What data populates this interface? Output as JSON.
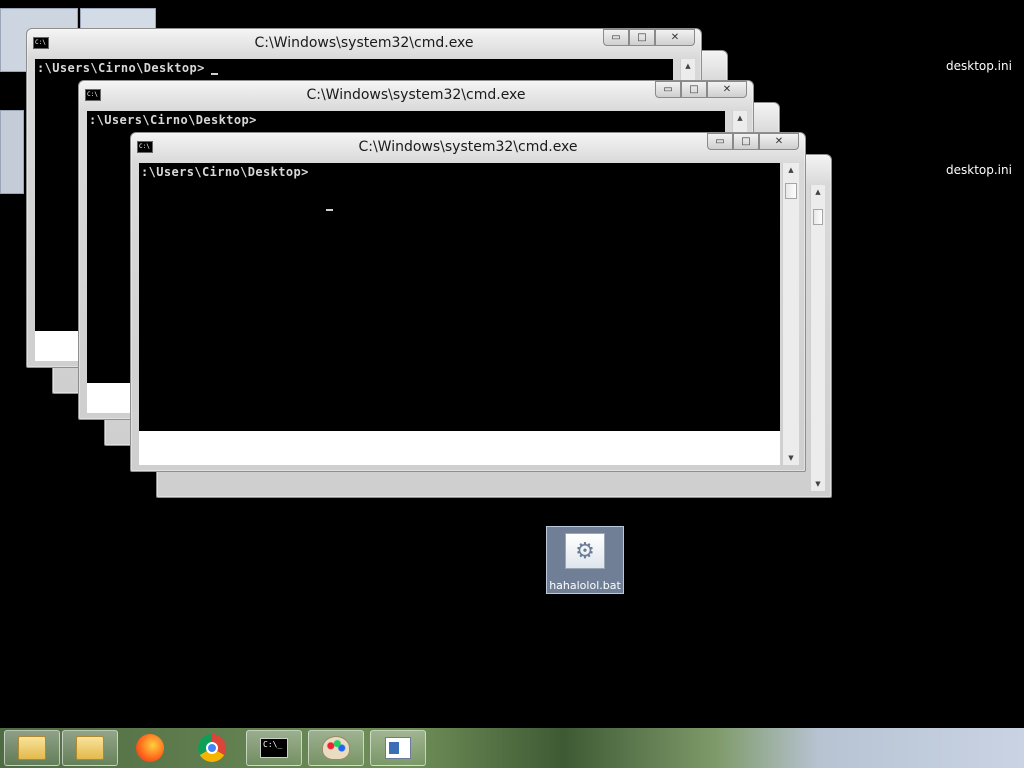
{
  "windows": [
    {
      "title": "C:\\Windows\\system32\\cmd.exe",
      "prompt": ":\\Users\\Cirno\\Desktop>"
    },
    {
      "title": "C:\\Windows\\system32\\cmd.exe",
      "prompt": ":\\Users\\Cirno\\Desktop>"
    },
    {
      "title": "C:\\Windows\\system32\\cmd.exe",
      "prompt": ":\\Users\\Cirno\\Desktop>"
    }
  ],
  "window_controls": {
    "minimize": "▭",
    "maximize": "□",
    "close": "✕"
  },
  "desktop": {
    "labels": [
      "desktop.ini",
      "desktop.ini"
    ],
    "icon": {
      "label": "hahalolol.bat",
      "icon": "batch-file-gear-icon"
    }
  },
  "taskbar": {
    "items": [
      {
        "icon": "folder-icon"
      },
      {
        "icon": "folder-icon"
      },
      {
        "icon": "firefox-icon"
      },
      {
        "icon": "chrome-icon"
      },
      {
        "icon": "cmd-icon",
        "text": "C:\\_"
      },
      {
        "icon": "paint-icon"
      },
      {
        "icon": "document-icon"
      }
    ]
  }
}
